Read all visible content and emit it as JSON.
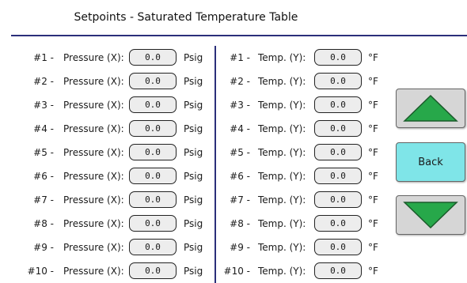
{
  "header": {
    "title": "Setpoints  - Saturated Temperature Table"
  },
  "rows": [
    {
      "num": "#1 -",
      "x_label": "Pressure (X):",
      "x_value": "0.0",
      "x_unit": "Psig",
      "num_r": "#1 -",
      "y_label": "Temp. (Y):",
      "y_value": "0.0",
      "y_unit": "°F"
    },
    {
      "num": "#2 -",
      "x_label": "Pressure (X):",
      "x_value": "0.0",
      "x_unit": "Psig",
      "num_r": "#2 -",
      "y_label": "Temp. (Y):",
      "y_value": "0.0",
      "y_unit": "°F"
    },
    {
      "num": "#3 -",
      "x_label": "Pressure (X):",
      "x_value": "0.0",
      "x_unit": "Psig",
      "num_r": "#3 -",
      "y_label": "Temp. (Y):",
      "y_value": "0.0",
      "y_unit": "°F"
    },
    {
      "num": "#4 -",
      "x_label": "Pressure (X):",
      "x_value": "0.0",
      "x_unit": "Psig",
      "num_r": "#4 -",
      "y_label": "Temp. (Y):",
      "y_value": "0.0",
      "y_unit": "°F"
    },
    {
      "num": "#5 -",
      "x_label": "Pressure (X):",
      "x_value": "0.0",
      "x_unit": "Psig",
      "num_r": "#5 -",
      "y_label": "Temp. (Y):",
      "y_value": "0.0",
      "y_unit": "°F"
    },
    {
      "num": "#6 -",
      "x_label": "Pressure (X):",
      "x_value": "0.0",
      "x_unit": "Psig",
      "num_r": "#6 -",
      "y_label": "Temp. (Y):",
      "y_value": "0.0",
      "y_unit": "°F"
    },
    {
      "num": "#7 -",
      "x_label": "Pressure (X):",
      "x_value": "0.0",
      "x_unit": "Psig",
      "num_r": "#7 -",
      "y_label": "Temp. (Y):",
      "y_value": "0.0",
      "y_unit": "°F"
    },
    {
      "num": "#8 -",
      "x_label": "Pressure (X):",
      "x_value": "0.0",
      "x_unit": "Psig",
      "num_r": "#8 -",
      "y_label": "Temp. (Y):",
      "y_value": "0.0",
      "y_unit": "°F"
    },
    {
      "num": "#9 -",
      "x_label": "Pressure (X):",
      "x_value": "0.0",
      "x_unit": "Psig",
      "num_r": "#9 -",
      "y_label": "Temp. (Y):",
      "y_value": "0.0",
      "y_unit": "°F"
    },
    {
      "num": "#10 -",
      "x_label": "Pressure (X):",
      "x_value": "0.0",
      "x_unit": "Psig",
      "num_r": "#10 -",
      "y_label": "Temp. (Y):",
      "y_value": "0.0",
      "y_unit": "°F"
    }
  ],
  "nav": {
    "up_icon": "triangle-up-icon",
    "back_label": "Back",
    "down_icon": "triangle-down-icon"
  },
  "colors": {
    "divider": "#2b2f7a",
    "arrow_fill": "#27a84a",
    "back_button": "#7fe5e8",
    "nav_button": "#d6d6d6"
  }
}
